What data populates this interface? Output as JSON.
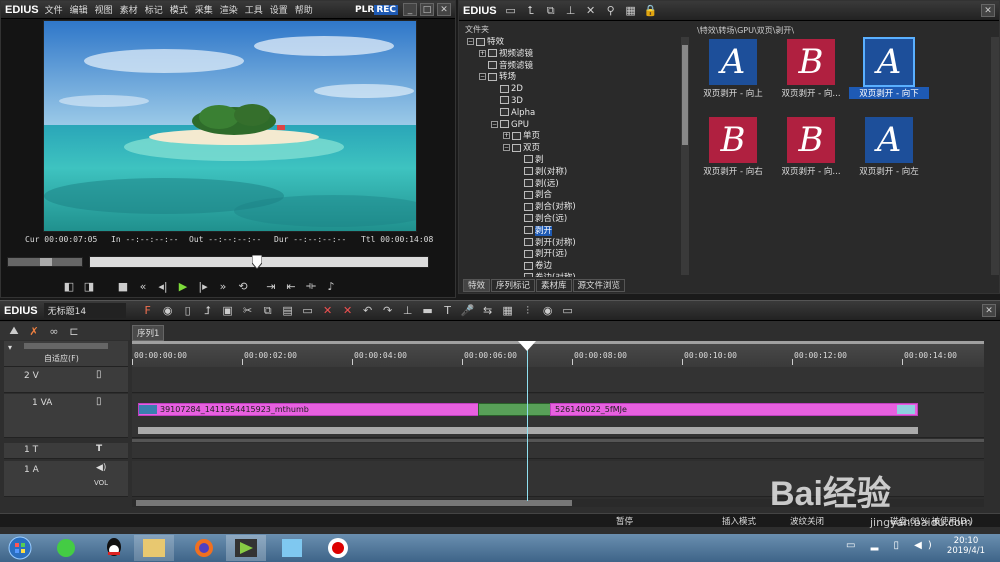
{
  "player": {
    "logo": "EDIUS",
    "menu": [
      "文件",
      "编辑",
      "视图",
      "素材",
      "标记",
      "模式",
      "采集",
      "渲染",
      "工具",
      "设置",
      "帮助"
    ],
    "plr": "PLR",
    "rec": "REC",
    "timecodes": {
      "cur_label": "Cur",
      "cur": "00:00:07:05",
      "in_label": "In",
      "in": "--:--:--:--",
      "out_label": "Out",
      "out": "--:--:--:--",
      "dur_label": "Dur",
      "dur": "--:--:--:--",
      "ttl_label": "Ttl",
      "ttl": "00:00:14:08"
    },
    "scrub_position": 0.49
  },
  "effects": {
    "logo": "EDIUS",
    "folder_header": "文件夹",
    "path": "\\特效\\转场\\GPU\\双页\\剥开\\",
    "tree": [
      {
        "label": "特效",
        "indent": 0,
        "pm": "-"
      },
      {
        "label": "视频滤镜",
        "indent": 1,
        "pm": "+"
      },
      {
        "label": "音频滤镜",
        "indent": 1,
        "pm": ""
      },
      {
        "label": "转场",
        "indent": 1,
        "pm": "-"
      },
      {
        "label": "2D",
        "indent": 2,
        "pm": ""
      },
      {
        "label": "3D",
        "indent": 2,
        "pm": ""
      },
      {
        "label": "Alpha",
        "indent": 2,
        "pm": ""
      },
      {
        "label": "GPU",
        "indent": 2,
        "pm": "-"
      },
      {
        "label": "单页",
        "indent": 3,
        "pm": "+"
      },
      {
        "label": "双页",
        "indent": 3,
        "pm": "-"
      },
      {
        "label": "剥",
        "indent": 4,
        "pm": ""
      },
      {
        "label": "剥(对称)",
        "indent": 4,
        "pm": ""
      },
      {
        "label": "剥(远)",
        "indent": 4,
        "pm": ""
      },
      {
        "label": "剥合",
        "indent": 4,
        "pm": ""
      },
      {
        "label": "剥合(对称)",
        "indent": 4,
        "pm": ""
      },
      {
        "label": "剥合(远)",
        "indent": 4,
        "pm": ""
      },
      {
        "label": "剥开",
        "indent": 4,
        "pm": "",
        "selected": true
      },
      {
        "label": "剥开(对称)",
        "indent": 4,
        "pm": ""
      },
      {
        "label": "剥开(远)",
        "indent": 4,
        "pm": ""
      },
      {
        "label": "卷边",
        "indent": 4,
        "pm": ""
      },
      {
        "label": "卷边(对称)",
        "indent": 4,
        "pm": ""
      }
    ],
    "tabs": [
      "特效",
      "序列标记",
      "素材库",
      "源文件浏览"
    ],
    "items": [
      {
        "letter": "A",
        "label": "双页剥开 - 向上",
        "bg": "#1d4f9a"
      },
      {
        "letter": "B",
        "label": "双页剥开 - 向...",
        "bg": "#b02040"
      },
      {
        "letter": "A",
        "label": "双页剥开 - 向下",
        "bg": "#1d4f9a",
        "selected": true
      },
      {
        "letter": "B",
        "label": "双页剥开 - 向右",
        "bg": "#b02040"
      },
      {
        "letter": "B",
        "label": "双页剥开 - 向...",
        "bg": "#b02040"
      },
      {
        "letter": "A",
        "label": "双页剥开 - 向左",
        "bg": "#1d4f9a"
      }
    ]
  },
  "timeline": {
    "logo": "EDIUS",
    "project": "无标题14",
    "sequence_tab": "序列1",
    "auto_mode": "自适应(F)",
    "ruler": [
      "00:00:00:00",
      "00:00:02:00",
      "00:00:04:00",
      "00:00:06:00",
      "00:00:08:00",
      "00:00:10:00",
      "00:00:12:00",
      "00:00:14:00"
    ],
    "tracks": {
      "v2": "2 V",
      "va1": "1 VA",
      "t1": "1 T",
      "a1": "1 A",
      "vol": "VOL"
    },
    "clip1": "39107284_1411954415923_mthumb",
    "clip2": "526140022_5fMJe",
    "status": {
      "pause": "暂停",
      "insert": "插入模式",
      "ripple": "波纹关闭",
      "disk": "磁盘:61% 被使用(D:)"
    }
  },
  "taskbar": {
    "time": "20:10",
    "date": "2019/4/1"
  },
  "watermark": {
    "brand": "Bai经验",
    "url": "jingyan.baidu.com"
  },
  "colors": {
    "clip": "#e860e0",
    "playhead": "#ffffff",
    "selection": "#1e5ab4"
  }
}
